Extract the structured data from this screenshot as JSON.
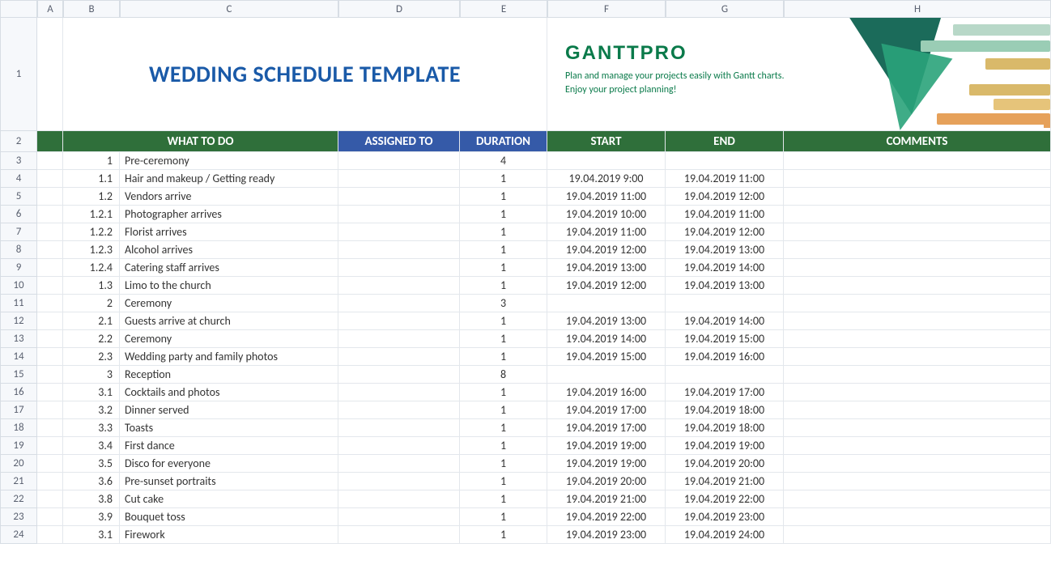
{
  "columns": [
    "A",
    "B",
    "C",
    "D",
    "E",
    "F",
    "G",
    "H"
  ],
  "rownums": [
    "1",
    "2",
    "3",
    "4",
    "5",
    "6",
    "7",
    "8",
    "9",
    "10",
    "11",
    "12",
    "13",
    "14",
    "15",
    "16",
    "17",
    "18",
    "19",
    "20",
    "21",
    "22",
    "23",
    "24"
  ],
  "title": "WEDDING SCHEDULE TEMPLATE",
  "brand": {
    "logo": "GANTTPRO",
    "line1": "Plan and manage your projects easily with Gantt charts.",
    "line2": "Enjoy your project planning!"
  },
  "headers": {
    "what": "WHAT TO DO",
    "assigned": "ASSIGNED TO",
    "duration": "DURATION",
    "start": "START",
    "end": "END",
    "comments": "COMMENTS"
  },
  "rows": [
    {
      "n": "1",
      "task": "Pre-ceremony",
      "dur": "4",
      "start": "",
      "end": ""
    },
    {
      "n": "1.1",
      "task": "Hair and makeup / Getting ready",
      "dur": "1",
      "start": "19.04.2019 9:00",
      "end": "19.04.2019 11:00"
    },
    {
      "n": "1.2",
      "task": "Vendors arrive",
      "dur": "1",
      "start": "19.04.2019 11:00",
      "end": "19.04.2019 12:00"
    },
    {
      "n": "1.2.1",
      "task": "Photographer arrives",
      "dur": "1",
      "start": "19.04.2019 10:00",
      "end": "19.04.2019 11:00"
    },
    {
      "n": "1.2.2",
      "task": "Florist arrives",
      "dur": "1",
      "start": "19.04.2019 11:00",
      "end": "19.04.2019 12:00"
    },
    {
      "n": "1.2.3",
      "task": "Alcohol arrives",
      "dur": "1",
      "start": "19.04.2019 12:00",
      "end": "19.04.2019 13:00"
    },
    {
      "n": "1.2.4",
      "task": "Catering staff arrives",
      "dur": "1",
      "start": "19.04.2019 13:00",
      "end": "19.04.2019 14:00"
    },
    {
      "n": "1.3",
      "task": "Limo to the church",
      "dur": "1",
      "start": "19.04.2019 12:00",
      "end": "19.04.2019 13:00"
    },
    {
      "n": "2",
      "task": "Ceremony",
      "dur": "3",
      "start": "",
      "end": ""
    },
    {
      "n": "2.1",
      "task": "Guests arrive at church",
      "dur": "1",
      "start": "19.04.2019 13:00",
      "end": "19.04.2019 14:00"
    },
    {
      "n": "2.2",
      "task": "Ceremony",
      "dur": "1",
      "start": "19.04.2019 14:00",
      "end": "19.04.2019 15:00"
    },
    {
      "n": "2.3",
      "task": "Wedding party and family photos",
      "dur": "1",
      "start": "19.04.2019 15:00",
      "end": "19.04.2019 16:00"
    },
    {
      "n": "3",
      "task": "Reception",
      "dur": "8",
      "start": "",
      "end": ""
    },
    {
      "n": "3.1",
      "task": "Cocktails and photos",
      "dur": "1",
      "start": "19.04.2019 16:00",
      "end": "19.04.2019 17:00"
    },
    {
      "n": "3.2",
      "task": "Dinner served",
      "dur": "1",
      "start": "19.04.2019 17:00",
      "end": "19.04.2019 18:00"
    },
    {
      "n": "3.3",
      "task": "Toasts",
      "dur": "1",
      "start": "19.04.2019 17:00",
      "end": "19.04.2019 18:00"
    },
    {
      "n": "3.4",
      "task": "First dance",
      "dur": "1",
      "start": "19.04.2019 19:00",
      "end": "19.04.2019 19:00"
    },
    {
      "n": "3.5",
      "task": "Disco for everyone",
      "dur": "1",
      "start": "19.04.2019 19:00",
      "end": "19.04.2019 20:00"
    },
    {
      "n": "3.6",
      "task": "Pre-sunset portraits",
      "dur": "1",
      "start": "19.04.2019 20:00",
      "end": "19.04.2019 21:00"
    },
    {
      "n": "3.8",
      "task": "Cut cake",
      "dur": "1",
      "start": "19.04.2019 21:00",
      "end": "19.04.2019 22:00"
    },
    {
      "n": "3.9",
      "task": "Bouquet toss",
      "dur": "1",
      "start": "19.04.2019 22:00",
      "end": "19.04.2019 23:00"
    },
    {
      "n": "3.1",
      "task": "Firework",
      "dur": "1",
      "start": "19.04.2019 23:00",
      "end": "19.04.2019 24:00"
    }
  ]
}
